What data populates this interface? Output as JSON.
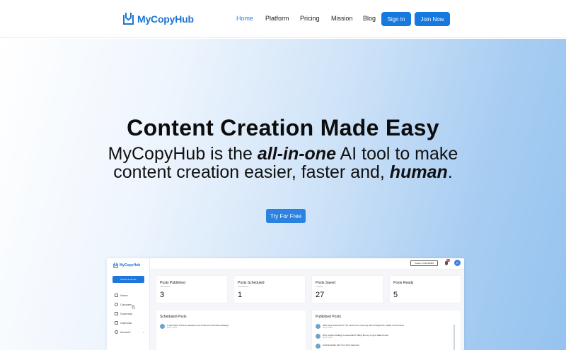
{
  "brand": {
    "name": "MyCopyHub",
    "color": "#1b74d6"
  },
  "nav": {
    "links": [
      {
        "label": "Home",
        "active": true
      },
      {
        "label": "Platform"
      },
      {
        "label": "Pricing"
      },
      {
        "label": "Mission"
      },
      {
        "label": "Blog"
      }
    ],
    "sign_in": "Sign In",
    "join_now": "Join Now"
  },
  "hero": {
    "title": "Content Creation Made Easy",
    "sub_1": "MyCopyHub is the ",
    "sub_em1": "all-in-one",
    "sub_2": " AI tool to make content creation easier, faster and, ",
    "sub_em2": "human",
    "sub_3": ".",
    "cta": "Try For Free"
  },
  "preview": {
    "brand": "MyCopyHub",
    "create_post": "CREATE POST",
    "menu": [
      {
        "label": "Home",
        "icon": "home-icon"
      },
      {
        "label": "Carousel",
        "icon": "eye-icon"
      },
      {
        "label": "Summary",
        "icon": "edit-icon"
      },
      {
        "label": "Calendar",
        "icon": "calendar-icon"
      },
      {
        "label": "Account",
        "icon": "user-icon"
      }
    ],
    "tokens": "Tokens: 2911/30000",
    "notification_count": "9+",
    "avatar_letter": "R",
    "stats": [
      {
        "title": "Posts Published",
        "sub": "This Month",
        "value": "3"
      },
      {
        "title": "Posts Scheduled",
        "sub": "This Month",
        "value": "1"
      },
      {
        "title": "Posts Saved",
        "sub": "In Draft",
        "value": "27"
      },
      {
        "title": "Posts Ready",
        "sub": "",
        "value": "5"
      }
    ],
    "scheduled": {
      "title": "Scheduled Posts",
      "posts": [
        {
          "text": "1 sign that it's time to reassess your bottom-of-the-funnel strategy.",
          "date": "May 7, 2024"
        }
      ]
    },
    "published": {
      "title": "Published Posts",
      "posts": [
        {
          "text": "Want loyal customers? The secret is in nurturing them through the middle of the funnel.",
          "date": "May 8, 2024"
        },
        {
          "text": "Why content strategy is essential for filling the top of your sales funnel.",
          "date": "May 6, 2024"
        },
        {
          "text": "Grab Eyeballs with Your Next Carousel",
          "date": ""
        }
      ]
    }
  }
}
